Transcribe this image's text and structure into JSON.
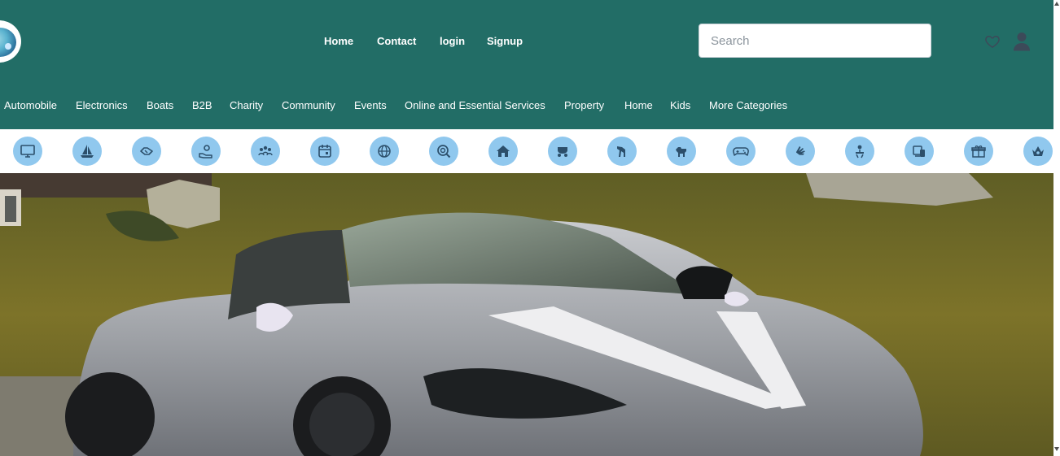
{
  "header": {
    "bg_color": "#226d66",
    "nav": [
      {
        "label": "Home"
      },
      {
        "label": "Contact"
      },
      {
        "label": "login"
      },
      {
        "label": "Signup"
      }
    ],
    "search": {
      "placeholder": "Search",
      "value": ""
    },
    "icons": [
      "heart-icon",
      "user-icon"
    ]
  },
  "categories": [
    "Automobile",
    "Electronics",
    "Boats",
    "B2B",
    "Charity",
    "Community",
    "Events",
    "Online and Essential Services",
    "Property",
    "Home",
    "Kids",
    "More Categories"
  ],
  "category_icons": [
    "monitor-icon",
    "sailboat-icon",
    "handshake-icon",
    "charity-hand-icon",
    "community-people-icon",
    "calendar-event-icon",
    "globe-icon",
    "search-zoom-icon",
    "house-icon",
    "stroller-icon",
    "horse-icon",
    "dog-icon",
    "gamepad-icon",
    "sign-language-icon",
    "person-service-icon",
    "devices-icon",
    "gift-icon",
    "pet-care-icon"
  ],
  "icon_color": "#90c8ee",
  "hero": {
    "alt": "Silver sports car decorated with white ribbons parked on grassy hillside"
  }
}
